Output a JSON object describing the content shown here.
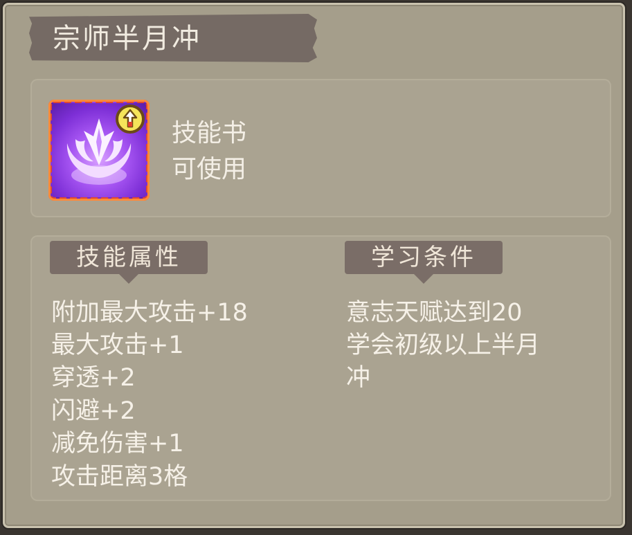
{
  "item": {
    "title": "宗师半月冲",
    "type": "技能书",
    "status": "可使用"
  },
  "icons": {
    "skill": "crescent-slash-icon",
    "badge": "upgrade-arrow-icon"
  },
  "tabs": {
    "attributes": "技能属性",
    "requirements": "学习条件"
  },
  "attributes": [
    "附加最大攻击+18",
    "最大攻击+1",
    "穿透+2",
    "闪避+2",
    "减免伤害+1",
    "攻击距离3格"
  ],
  "requirements": [
    "意志天赋达到20",
    "学会初级以上半月",
    "冲"
  ],
  "colors": {
    "panel": "#a59e8b",
    "banner": "#756a64",
    "tab": "#7a6d67",
    "text": "#f4efe6",
    "icon_border": "#e04a30",
    "icon_fill": "#a655f2"
  }
}
